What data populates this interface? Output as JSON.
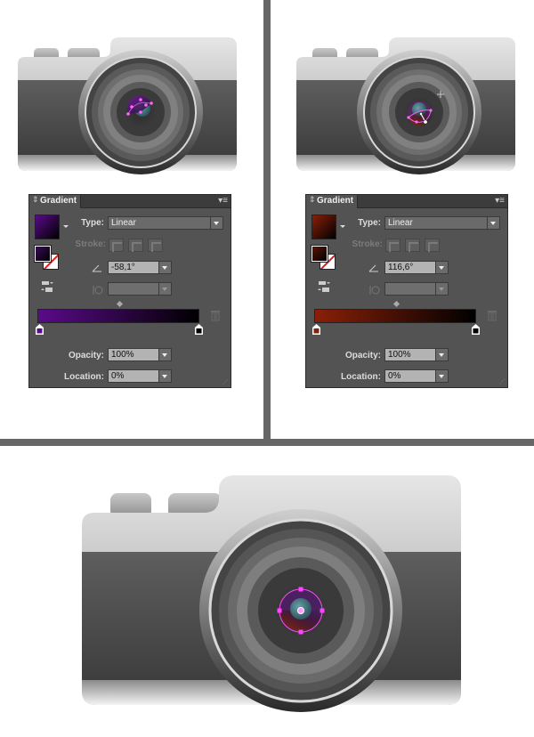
{
  "layout": {
    "divider_color": "#666666"
  },
  "steps": [
    {
      "camera": {
        "name": "camera-step-1",
        "gradient_start": "#5b0a8c",
        "gradient_end": "#000000",
        "handle_color": "#ff44ff"
      },
      "panel": {
        "title": "Gradient",
        "type_label": "Type:",
        "type_value": "Linear",
        "stroke_label": "Stroke:",
        "angle_value": "-58,1°",
        "aspect_value": "",
        "opacity_label": "Opacity:",
        "opacity_value": "100%",
        "location_label": "Location:",
        "location_value": "0%",
        "gradient_start_color": "#5a0a8a",
        "gradient_end_color": "#000000",
        "selected_stop": "left",
        "icons": {
          "tab_arrows": "updown-arrows-icon",
          "menu": "panel-menu-icon",
          "reverse": "reverse-gradient-icon",
          "angle": "angle-icon",
          "aspect": "aspect-ratio-icon",
          "trash": "delete-stop-icon",
          "grip": "resize-grip-icon"
        }
      }
    },
    {
      "camera": {
        "name": "camera-step-2",
        "gradient_start": "#8a1f08",
        "gradient_end": "#000000",
        "handle_color": "#ff44ff"
      },
      "panel": {
        "title": "Gradient",
        "type_label": "Type:",
        "type_value": "Linear",
        "stroke_label": "Stroke:",
        "angle_value": "116,6°",
        "aspect_value": "",
        "opacity_label": "Opacity:",
        "opacity_value": "100%",
        "location_label": "Location:",
        "location_value": "0%",
        "gradient_start_color": "#8a1f08",
        "gradient_end_color": "#000000",
        "selected_stop": "left",
        "icons": {
          "tab_arrows": "updown-arrows-icon",
          "menu": "panel-menu-icon",
          "reverse": "reverse-gradient-icon",
          "angle": "angle-icon",
          "aspect": "aspect-ratio-icon",
          "trash": "delete-stop-icon",
          "grip": "resize-grip-icon"
        }
      }
    }
  ],
  "result": {
    "camera": {
      "name": "camera-result",
      "selection_color": "#ff44ff"
    }
  },
  "glyphs": {
    "tab_arrows": "⇕",
    "menu": "▾≡",
    "grip": "⋰"
  }
}
